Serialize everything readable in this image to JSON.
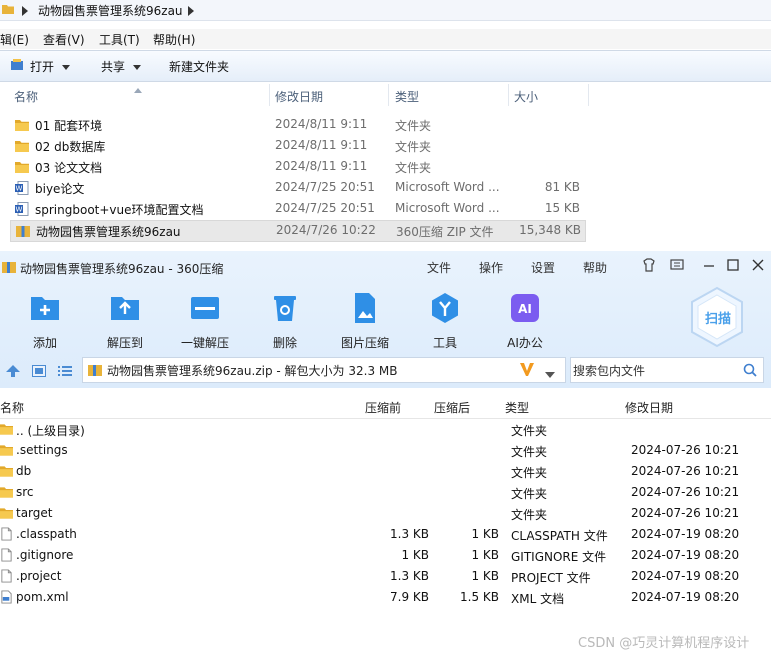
{
  "explorer": {
    "address_segment": "动物园售票管理系统96zau",
    "menu": [
      "辑(E)",
      "查看(V)",
      "工具(T)",
      "帮助(H)"
    ],
    "toolbar": {
      "open": "打开",
      "share": "共享",
      "new_folder": "新建文件夹"
    },
    "columns": {
      "name": "名称",
      "date": "修改日期",
      "type": "类型",
      "size": "大小"
    },
    "files": [
      {
        "name": "01 配套环境",
        "date": "2024/8/11 9:11",
        "type": "文件夹",
        "size": "",
        "icon": "folder-icon"
      },
      {
        "name": "02 db数据库",
        "date": "2024/8/11 9:11",
        "type": "文件夹",
        "size": "",
        "icon": "folder-icon"
      },
      {
        "name": "03 论文文档",
        "date": "2024/8/11 9:11",
        "type": "文件夹",
        "size": "",
        "icon": "folder-icon"
      },
      {
        "name": "biye论文",
        "date": "2024/7/25 20:51",
        "type": "Microsoft Word ...",
        "size": "81 KB",
        "icon": "word-doc-icon"
      },
      {
        "name": "springboot+vue环境配置文档",
        "date": "2024/7/25 20:51",
        "type": "Microsoft Word ...",
        "size": "15 KB",
        "icon": "word-doc-icon"
      },
      {
        "name": "动物园售票管理系统96zau",
        "date": "2024/7/26 10:22",
        "type": "360压缩 ZIP 文件",
        "size": "15,348 KB",
        "icon": "zip-icon"
      }
    ]
  },
  "archiver": {
    "title": "动物园售票管理系统96zau - 360压缩",
    "menu": [
      "文件",
      "操作",
      "设置",
      "帮助"
    ],
    "actions": [
      {
        "label": "添加",
        "icon": "add-icon",
        "color": "#2f8fe6"
      },
      {
        "label": "解压到",
        "icon": "extract-to-icon",
        "color": "#2f8fe6"
      },
      {
        "label": "一键解压",
        "icon": "one-click-extract-icon",
        "color": "#2f8fe6"
      },
      {
        "label": "删除",
        "icon": "delete-icon",
        "color": "#2f8fe6"
      },
      {
        "label": "图片压缩",
        "icon": "image-compress-icon",
        "color": "#2f8fe6"
      },
      {
        "label": "工具",
        "icon": "tools-icon",
        "color": "#2f8fe6"
      },
      {
        "label": "AI办公",
        "icon": "ai-office-icon",
        "color": "#7b5cf0"
      }
    ],
    "scan_label": "扫描",
    "path_text": "动物园售票管理系统96zau.zip - 解包大小为 32.3 MB",
    "search_placeholder": "搜索包内文件",
    "columns": {
      "name": "名称",
      "compressed": "压缩前",
      "packed": "压缩后",
      "type": "类型",
      "date": "修改日期"
    },
    "rows": [
      {
        "name": ".. (上级目录)",
        "before": "",
        "after": "",
        "type": "文件夹",
        "date": "",
        "icon": "folder-icon"
      },
      {
        "name": ".settings",
        "before": "",
        "after": "",
        "type": "文件夹",
        "date": "2024-07-26 10:21",
        "icon": "folder-icon"
      },
      {
        "name": "db",
        "before": "",
        "after": "",
        "type": "文件夹",
        "date": "2024-07-26 10:21",
        "icon": "folder-icon"
      },
      {
        "name": "src",
        "before": "",
        "after": "",
        "type": "文件夹",
        "date": "2024-07-26 10:21",
        "icon": "folder-icon"
      },
      {
        "name": "target",
        "before": "",
        "after": "",
        "type": "文件夹",
        "date": "2024-07-26 10:21",
        "icon": "folder-icon"
      },
      {
        "name": ".classpath",
        "before": "1.3 KB",
        "after": "1 KB",
        "type": "CLASSPATH 文件",
        "date": "2024-07-19 08:20",
        "icon": "file-icon"
      },
      {
        "name": ".gitignore",
        "before": "1 KB",
        "after": "1 KB",
        "type": "GITIGNORE 文件",
        "date": "2024-07-19 08:20",
        "icon": "file-icon"
      },
      {
        "name": ".project",
        "before": "1.3 KB",
        "after": "1 KB",
        "type": "PROJECT 文件",
        "date": "2024-07-19 08:20",
        "icon": "file-icon"
      },
      {
        "name": "pom.xml",
        "before": "7.9 KB",
        "after": "1.5 KB",
        "type": "XML 文档",
        "date": "2024-07-19 08:20",
        "icon": "xml-file-icon"
      }
    ]
  },
  "watermark": "CSDN @巧灵计算机程序设计"
}
